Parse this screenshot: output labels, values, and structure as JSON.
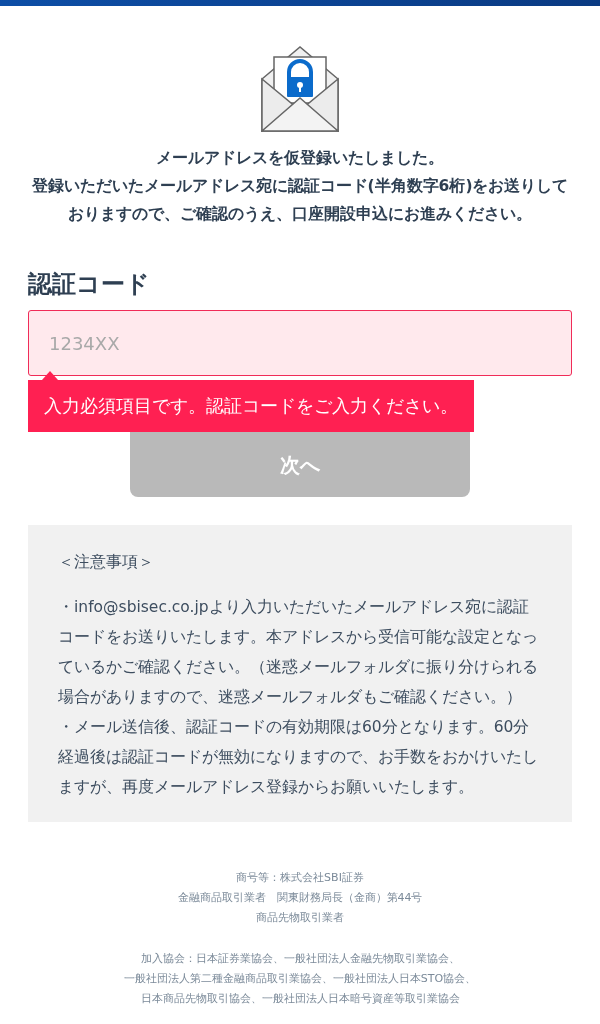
{
  "message": [
    "メールアドレスを仮登録いたしました。",
    "登録いただいたメールアドレス宛に認証コード(半角数字6桁)をお送りしておりますので、ご確認のうえ、口座開設申込にお進みください。"
  ],
  "field": {
    "label": "認証コード",
    "placeholder": "1234XX",
    "invalid": true,
    "error": "入力必須項目です。認証コードをご入力ください。"
  },
  "next_button": {
    "label": "次へ",
    "disabled": true
  },
  "notice": {
    "title": "＜注意事項＞",
    "items": [
      "・info@sbisec.co.jpより入力いただいたメールアドレス宛に認証コードをお送りいたします。本アドレスから受信可能な設定となっているかご確認ください。（迷惑メールフォルダに振り分けられる場合がありますので、迷惑メールフォルダもご確認ください。）",
      "・メール送信後、認証コードの有効期限は60分となります。60分経過後は認証コードが無効になりますので、お手数をおかけいたしますが、再度メールアドレス登録からお願いいたします。"
    ]
  },
  "footer": [
    [
      "商号等：株式会社SBI証券",
      "金融商品取引業者　関東財務局長（金商）第44号",
      "商品先物取引業者"
    ],
    [
      "加入協会：日本証券業協会、一般社団法人金融先物取引業協会、",
      "一般社団法人第二種金融商品取引業協会、一般社団法人日本STO協会、",
      "日本商品先物取引協会、一般社団法人日本暗号資産等取引業協会"
    ]
  ]
}
